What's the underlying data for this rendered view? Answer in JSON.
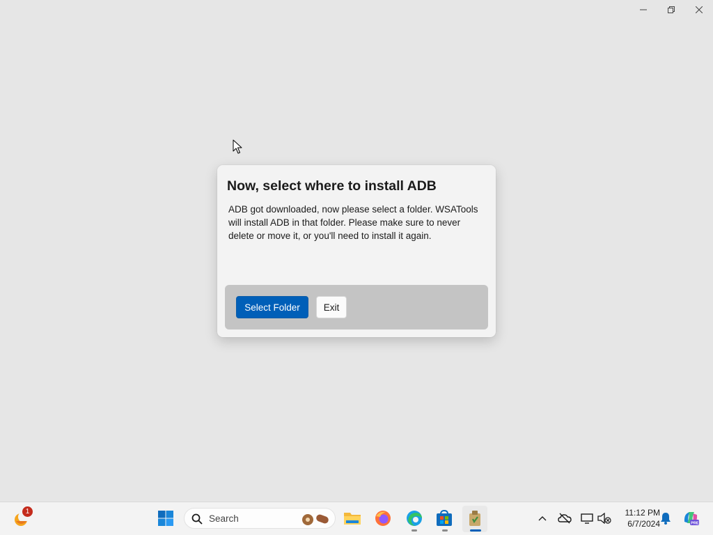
{
  "window": {
    "controls": [
      {
        "name": "minimize",
        "icon": "minimize-icon"
      },
      {
        "name": "restore",
        "icon": "restore-icon"
      },
      {
        "name": "close",
        "icon": "close-icon"
      }
    ]
  },
  "dialog": {
    "title": "Now, select where to install ADB",
    "body": "ADB got downloaded, now please select a folder. WSATools will install ADB in that folder. Please make sure to never delete or move it, or you'll need to install it again.",
    "primary_button": "Select Folder",
    "secondary_button": "Exit"
  },
  "taskbar": {
    "widgets_badge": "1",
    "search_placeholder": "Search",
    "pinned": [
      "start-icon",
      "file-explorer-icon",
      "firefox-icon",
      "edge-icon",
      "microsoft-store-icon",
      "wsatools-icon"
    ],
    "clock": {
      "time": "11:12 PM",
      "date": "6/7/2024"
    },
    "accent": "#005fb8"
  }
}
